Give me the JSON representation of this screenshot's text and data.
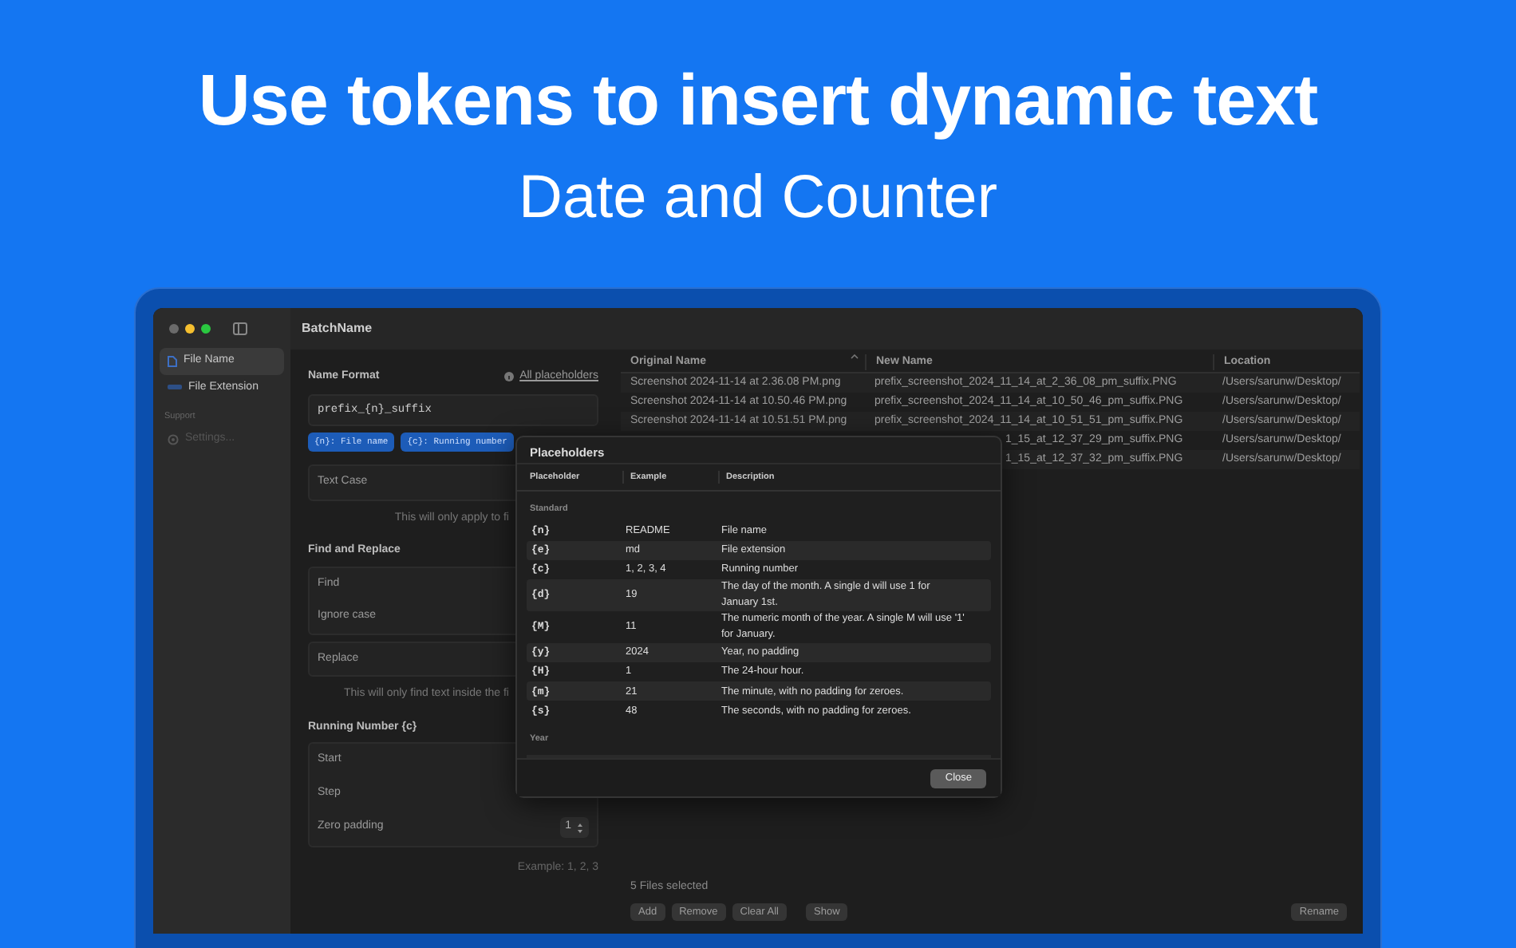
{
  "headline": "Use tokens to insert dynamic text",
  "subheadline": "Date and Counter",
  "window": {
    "title": "BatchName"
  },
  "sidebar": {
    "items": [
      {
        "label": "File Name",
        "selected": true
      },
      {
        "label": "File Extension",
        "selected": false
      }
    ],
    "section": "Support",
    "support_items": [
      {
        "label": "Settings...",
        "selected": false
      }
    ]
  },
  "name_format": {
    "title": "Name Format",
    "link": "All placeholders",
    "value": "prefix_{n}_suffix",
    "tokens": [
      "{n}: File name",
      "{c}: Running number"
    ]
  },
  "text_case": {
    "label": "Text Case",
    "note": "This will only apply to fi"
  },
  "find_replace": {
    "title": "Find and Replace",
    "rows": [
      "Find",
      "Ignore case"
    ],
    "replace": "Replace",
    "note": "This will only find text inside the fi"
  },
  "running_number": {
    "title": "Running Number {c}",
    "rows": [
      {
        "label": "Start"
      },
      {
        "label": "Step"
      },
      {
        "label": "Zero padding",
        "value": "1"
      }
    ],
    "example": "Example: 1, 2, 3"
  },
  "table": {
    "columns": [
      {
        "label": "Original Name",
        "sorted": true
      },
      {
        "label": "New Name",
        "sorted": false
      },
      {
        "label": "Location",
        "sorted": false
      }
    ],
    "rows": [
      {
        "original": "Screenshot 2024-11-14 at 2.36.08 PM.png",
        "new": "prefix_screenshot_2024_11_14_at_2_36_08_pm_suffix.PNG",
        "location": "/Users/sarunw/Desktop/"
      },
      {
        "original": "Screenshot 2024-11-14 at 10.50.46 PM.png",
        "new": "prefix_screenshot_2024_11_14_at_10_50_46_pm_suffix.PNG",
        "location": "/Users/sarunw/Desktop/"
      },
      {
        "original": "Screenshot 2024-11-14 at 10.51.51 PM.png",
        "new": "prefix_screenshot_2024_11_14_at_10_51_51_pm_suffix.PNG",
        "location": "/Users/sarunw/Desktop/"
      },
      {
        "new": "1_15_at_12_37_29_pm_suffix.PNG",
        "location": "/Users/sarunw/Desktop/"
      },
      {
        "new": "1_15_at_12_37_32_pm_suffix.PNG",
        "location": "/Users/sarunw/Desktop/"
      }
    ]
  },
  "footer": {
    "status": "5 Files selected",
    "buttons": [
      "Add",
      "Remove",
      "Clear All",
      "Show"
    ],
    "action": "Rename"
  },
  "dialog": {
    "title": "Placeholders",
    "columns": [
      "Placeholder",
      "Example",
      "Description"
    ],
    "sections": [
      {
        "title": "Standard",
        "rows": [
          {
            "token": "{n}",
            "example": "README",
            "description": "File name"
          },
          {
            "token": "{e}",
            "example": "md",
            "description": "File extension"
          },
          {
            "token": "{c}",
            "example": "1, 2, 3, 4",
            "description": "Running number"
          },
          {
            "token": "{d}",
            "example": "19",
            "description": "The day of the month. A single d will use 1 for January 1st."
          },
          {
            "token": "{M}",
            "example": "11",
            "description": "The numeric month of the year. A single M will use '1' for January."
          },
          {
            "token": "{y}",
            "example": "2024",
            "description": "Year, no padding"
          },
          {
            "token": "{H}",
            "example": "1",
            "description": "The 24-hour hour."
          },
          {
            "token": "{m}",
            "example": "21",
            "description": "The minute, with no padding for zeroes."
          },
          {
            "token": "{s}",
            "example": "48",
            "description": "The seconds, with no padding for zeroes."
          }
        ]
      },
      {
        "title": "Year"
      }
    ],
    "close": "Close"
  }
}
